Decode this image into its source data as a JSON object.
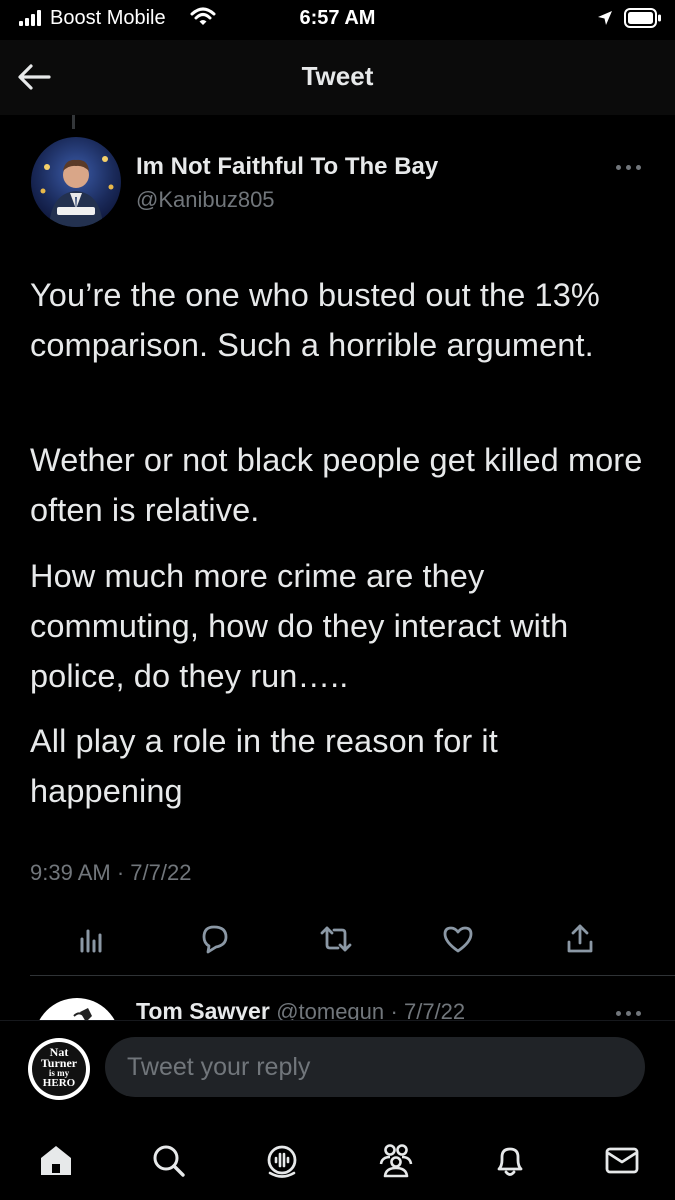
{
  "status_bar": {
    "carrier": "Boost Mobile",
    "time": "6:57 AM",
    "icons": [
      "signal-icon",
      "wifi-icon",
      "location-arrow-icon",
      "battery-icon"
    ]
  },
  "header": {
    "title": "Tweet",
    "back_icon": "back-arrow-icon"
  },
  "tweet": {
    "author_name": "Im Not Faithful To The Bay",
    "author_handle": "@Kanibuz805",
    "paragraphs": [
      "You’re the one who busted out the 13% comparison. Such a horrible argument.",
      "Wether or not black people get killed more often is relative.",
      "How much more crime are they commuting, how do they interact with police, do they run…..",
      "All play a role in the reason for it happening"
    ],
    "timestamp": "9:39 AM · 7/7/22",
    "actions": [
      "analytics-icon",
      "reply-icon",
      "retweet-icon",
      "like-icon",
      "share-icon"
    ]
  },
  "reply_preview": {
    "name": "Tom Sawyer",
    "handle": "@tomegun",
    "date": "· 7/7/22"
  },
  "composer": {
    "avatar_text": [
      "Nat",
      "Turner",
      "is my",
      "HERO"
    ],
    "placeholder": "Tweet your reply"
  },
  "tabbar": {
    "items": [
      "home-icon",
      "search-icon",
      "spaces-icon",
      "communities-icon",
      "notifications-icon",
      "messages-icon"
    ]
  },
  "colors": {
    "background": "#000000",
    "text": "#e7e9ea",
    "muted": "#71767b",
    "divider": "#2f3336",
    "input_bg": "#202327"
  }
}
